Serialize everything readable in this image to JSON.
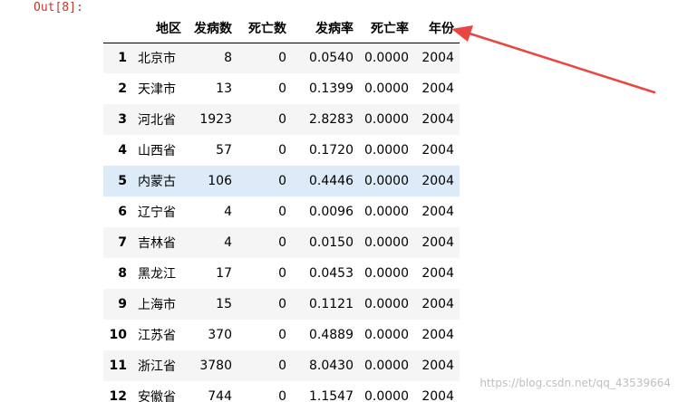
{
  "prompt": "Out[8]:",
  "table": {
    "columns": [
      "地区",
      "发病数",
      "死亡数",
      "发病率",
      "死亡率",
      "年份"
    ],
    "rows": [
      {
        "index": "1",
        "region": "北京市",
        "cases": "8",
        "deaths": "0",
        "incidence": "0.0540",
        "mortality": "0.0000",
        "year": "2004"
      },
      {
        "index": "2",
        "region": "天津市",
        "cases": "13",
        "deaths": "0",
        "incidence": "0.1399",
        "mortality": "0.0000",
        "year": "2004"
      },
      {
        "index": "3",
        "region": "河北省",
        "cases": "1923",
        "deaths": "0",
        "incidence": "2.8283",
        "mortality": "0.0000",
        "year": "2004"
      },
      {
        "index": "4",
        "region": "山西省",
        "cases": "57",
        "deaths": "0",
        "incidence": "0.1720",
        "mortality": "0.0000",
        "year": "2004"
      },
      {
        "index": "5",
        "region": "内蒙古",
        "cases": "106",
        "deaths": "0",
        "incidence": "0.4446",
        "mortality": "0.0000",
        "year": "2004"
      },
      {
        "index": "6",
        "region": "辽宁省",
        "cases": "4",
        "deaths": "0",
        "incidence": "0.0096",
        "mortality": "0.0000",
        "year": "2004"
      },
      {
        "index": "7",
        "region": "吉林省",
        "cases": "4",
        "deaths": "0",
        "incidence": "0.0150",
        "mortality": "0.0000",
        "year": "2004"
      },
      {
        "index": "8",
        "region": "黑龙江",
        "cases": "17",
        "deaths": "0",
        "incidence": "0.0453",
        "mortality": "0.0000",
        "year": "2004"
      },
      {
        "index": "9",
        "region": "上海市",
        "cases": "15",
        "deaths": "0",
        "incidence": "0.1121",
        "mortality": "0.0000",
        "year": "2004"
      },
      {
        "index": "10",
        "region": "江苏省",
        "cases": "370",
        "deaths": "0",
        "incidence": "0.4889",
        "mortality": "0.0000",
        "year": "2004"
      },
      {
        "index": "11",
        "region": "浙江省",
        "cases": "3780",
        "deaths": "0",
        "incidence": "8.0430",
        "mortality": "0.0000",
        "year": "2004"
      },
      {
        "index": "12",
        "region": "安徽省",
        "cases": "744",
        "deaths": "0",
        "incidence": "1.1547",
        "mortality": "0.0000",
        "year": "2004"
      }
    ],
    "highlighted_row_index": "5"
  },
  "annotation": {
    "icon": "red-arrow-icon",
    "color": "#e8463f"
  },
  "watermark": "https://blog.csdn.net/qq_43539664",
  "colors": {
    "prompt": "#c0392b",
    "row_stripe": "#f5f5f5",
    "row_hover": "#dcebf7"
  }
}
